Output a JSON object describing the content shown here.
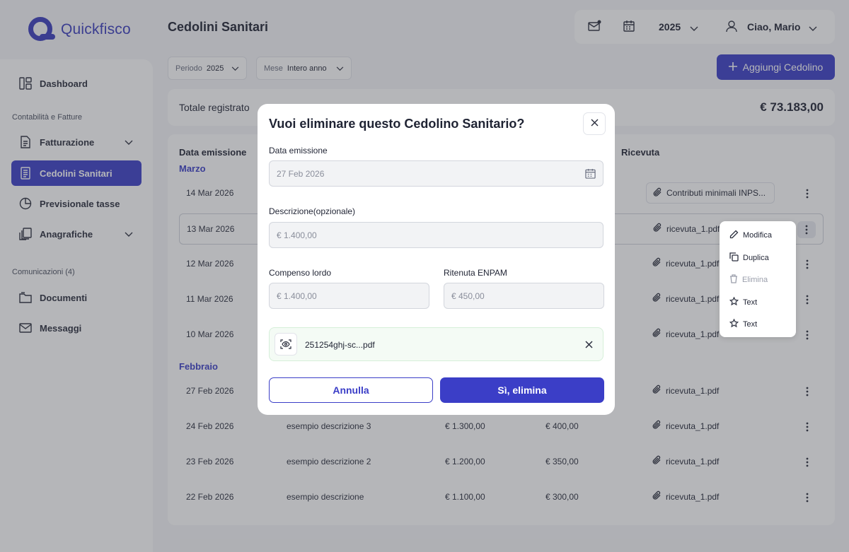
{
  "app": {
    "name": "Quickfisco"
  },
  "sidebar": {
    "items": [
      {
        "label": "Dashboard"
      },
      {
        "label": "Fatturazione"
      },
      {
        "label": "Cedolini Sanitari"
      },
      {
        "label": "Previsionale tasse"
      },
      {
        "label": "Anagrafiche"
      },
      {
        "label": "Documenti"
      },
      {
        "label": "Messaggi"
      }
    ],
    "sections": [
      "Contabilità e Fatture",
      "Comunicazioni (4)"
    ]
  },
  "header": {
    "title": "Cedolini Sanitari",
    "year": "2025",
    "greeting": "Ciao, Mario"
  },
  "filters": {
    "period_label": "Periodo",
    "period_value": "2025",
    "month_label": "Mese",
    "month_value": "Intero anno",
    "add_button": "Aggiungi Cedolino"
  },
  "total": {
    "label": "Totale registrato",
    "value": "€ 73.183,00"
  },
  "table": {
    "columns": [
      "Data emissione",
      "Ricevuta"
    ],
    "groups": [
      "Marzo",
      "Febbraio"
    ],
    "rows": [
      {
        "date": "14 Mar 2026",
        "receipt": "Contributi minimali INPS..."
      },
      {
        "date": "13 Mar 2026",
        "receipt": "ricevuta_1.pdf"
      },
      {
        "date": "12 Mar 2026",
        "receipt": "ricevuta_1.pdf"
      },
      {
        "date": "11 Mar 2026",
        "receipt": "ricevuta_1.pdf"
      },
      {
        "date": "10 Mar 2026",
        "receipt": "ricevuta_1.pdf"
      },
      {
        "date": "27 Feb 2026",
        "receipt": "ricevuta_1.pdf"
      },
      {
        "date": "24 Feb 2026",
        "desc": "esempio descrizione 3",
        "gross": "€ 1.300,00",
        "enpam": "€ 400,00",
        "receipt": "ricevuta_1.pdf"
      },
      {
        "date": "23 Feb 2026",
        "desc": "esempio descrizione 2",
        "gross": "€ 1.200,00",
        "enpam": "€ 350,00",
        "receipt": "ricevuta_1.pdf"
      },
      {
        "date": "22 Feb 2026",
        "desc": "esempio descrizione",
        "gross": "€ 1.100,00",
        "enpam": "€ 300,00",
        "receipt": "ricevuta_1.pdf"
      }
    ]
  },
  "context_menu": {
    "items": [
      "Modifica",
      "Duplica",
      "Elimina",
      "Text",
      "Text"
    ]
  },
  "modal": {
    "title": "Vuoi eliminare questo Cedolino Sanitario?",
    "date_label": "Data emissione",
    "date_value": "27 Feb 2026",
    "desc_label": "Descrizione(opzionale)",
    "desc_value": "€ 1.400,00",
    "gross_label": "Compenso lordo",
    "gross_value": "€ 1.400,00",
    "enpam_label": "Ritenuta ENPAM",
    "enpam_value": "€ 450,00",
    "file_name": "251254ghj-sc...pdf",
    "cancel": "Annulla",
    "confirm": "Sì, elimina"
  },
  "colors": {
    "primary": "#3b3ec7",
    "file_bg": "#f4fbf5"
  }
}
